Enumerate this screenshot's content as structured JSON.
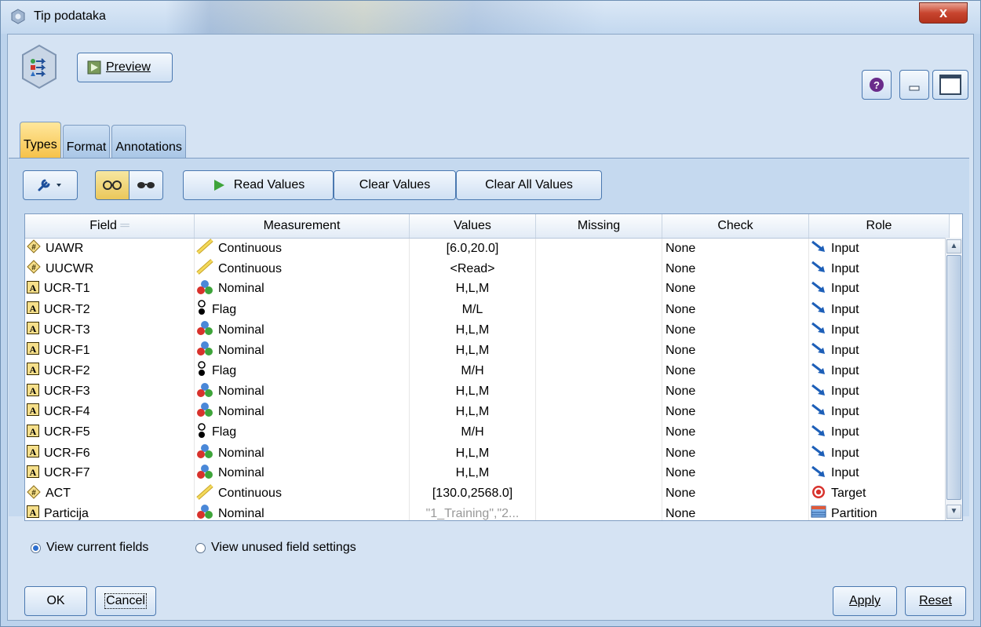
{
  "window": {
    "title": "Tip podataka",
    "close_label": "x"
  },
  "toolbar": {
    "preview_label": "Preview"
  },
  "tabs": [
    {
      "label": "Types",
      "active": true
    },
    {
      "label": "Format",
      "active": false
    },
    {
      "label": "Annotations",
      "active": false
    }
  ],
  "actions": {
    "read_values": "Read Values",
    "clear_values": "Clear Values",
    "clear_all_values": "Clear All Values"
  },
  "table": {
    "columns": [
      "Field",
      "Measurement",
      "Values",
      "Missing",
      "Check",
      "Role"
    ],
    "rows": [
      {
        "field": "UAWR",
        "type_icon": "continuous-field-icon",
        "measurement": "Continuous",
        "measure_icon": "ruler-icon",
        "values": "[6.0,20.0]",
        "missing": "",
        "check": "None",
        "role": "Input",
        "role_icon": "input-arrow-icon"
      },
      {
        "field": "UUCWR",
        "type_icon": "continuous-field-icon",
        "measurement": "Continuous",
        "measure_icon": "ruler-icon",
        "values": "<Read>",
        "missing": "",
        "check": "None",
        "role": "Input",
        "role_icon": "input-arrow-icon"
      },
      {
        "field": "UCR-T1",
        "type_icon": "string-field-icon",
        "measurement": "Nominal",
        "measure_icon": "nominal-icon",
        "values": "H,L,M",
        "missing": "",
        "check": "None",
        "role": "Input",
        "role_icon": "input-arrow-icon"
      },
      {
        "field": "UCR-T2",
        "type_icon": "string-field-icon",
        "measurement": "Flag",
        "measure_icon": "flag-icon",
        "values": "M/L",
        "missing": "",
        "check": "None",
        "role": "Input",
        "role_icon": "input-arrow-icon"
      },
      {
        "field": "UCR-T3",
        "type_icon": "string-field-icon",
        "measurement": "Nominal",
        "measure_icon": "nominal-icon",
        "values": "H,L,M",
        "missing": "",
        "check": "None",
        "role": "Input",
        "role_icon": "input-arrow-icon"
      },
      {
        "field": "UCR-F1",
        "type_icon": "string-field-icon",
        "measurement": "Nominal",
        "measure_icon": "nominal-icon",
        "values": "H,L,M",
        "missing": "",
        "check": "None",
        "role": "Input",
        "role_icon": "input-arrow-icon"
      },
      {
        "field": "UCR-F2",
        "type_icon": "string-field-icon",
        "measurement": "Flag",
        "measure_icon": "flag-icon",
        "values": "M/H",
        "missing": "",
        "check": "None",
        "role": "Input",
        "role_icon": "input-arrow-icon"
      },
      {
        "field": "UCR-F3",
        "type_icon": "string-field-icon",
        "measurement": "Nominal",
        "measure_icon": "nominal-icon",
        "values": "H,L,M",
        "missing": "",
        "check": "None",
        "role": "Input",
        "role_icon": "input-arrow-icon"
      },
      {
        "field": "UCR-F4",
        "type_icon": "string-field-icon",
        "measurement": "Nominal",
        "measure_icon": "nominal-icon",
        "values": "H,L,M",
        "missing": "",
        "check": "None",
        "role": "Input",
        "role_icon": "input-arrow-icon"
      },
      {
        "field": "UCR-F5",
        "type_icon": "string-field-icon",
        "measurement": "Flag",
        "measure_icon": "flag-icon",
        "values": "M/H",
        "missing": "",
        "check": "None",
        "role": "Input",
        "role_icon": "input-arrow-icon"
      },
      {
        "field": "UCR-F6",
        "type_icon": "string-field-icon",
        "measurement": "Nominal",
        "measure_icon": "nominal-icon",
        "values": "H,L,M",
        "missing": "",
        "check": "None",
        "role": "Input",
        "role_icon": "input-arrow-icon"
      },
      {
        "field": "UCR-F7",
        "type_icon": "string-field-icon",
        "measurement": "Nominal",
        "measure_icon": "nominal-icon",
        "values": "H,L,M",
        "missing": "",
        "check": "None",
        "role": "Input",
        "role_icon": "input-arrow-icon"
      },
      {
        "field": "ACT",
        "type_icon": "continuous-field-icon",
        "measurement": "Continuous",
        "measure_icon": "ruler-icon",
        "values": "[130.0,2568.0]",
        "missing": "",
        "check": "None",
        "role": "Target",
        "role_icon": "target-icon"
      },
      {
        "field": "Particija",
        "type_icon": "string-field-icon",
        "measurement": "Nominal",
        "measure_icon": "nominal-icon",
        "values": "\"1_Training\",\"2...",
        "values_greyed": true,
        "missing": "",
        "check": "None",
        "role": "Partition",
        "role_icon": "partition-icon"
      }
    ]
  },
  "view_options": {
    "current": "View current fields",
    "unused": "View unused field settings",
    "selected": "current"
  },
  "buttons": {
    "ok": "OK",
    "cancel": "Cancel",
    "apply": "Apply",
    "reset": "Reset"
  }
}
